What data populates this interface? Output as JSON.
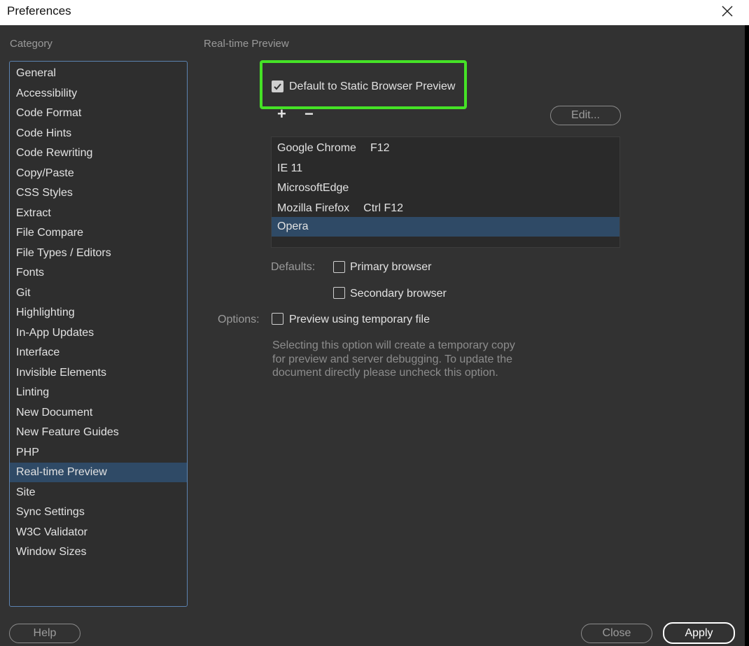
{
  "window": {
    "title": "Preferences",
    "close_icon": "close-icon"
  },
  "sidebar": {
    "heading": "Category",
    "items": [
      {
        "label": "General"
      },
      {
        "label": "Accessibility"
      },
      {
        "label": "Code Format"
      },
      {
        "label": "Code Hints"
      },
      {
        "label": "Code Rewriting"
      },
      {
        "label": "Copy/Paste"
      },
      {
        "label": "CSS Styles"
      },
      {
        "label": "Extract"
      },
      {
        "label": "File Compare"
      },
      {
        "label": "File Types / Editors"
      },
      {
        "label": "Fonts"
      },
      {
        "label": "Git"
      },
      {
        "label": "Highlighting"
      },
      {
        "label": "In-App Updates"
      },
      {
        "label": "Interface"
      },
      {
        "label": "Invisible Elements"
      },
      {
        "label": "Linting"
      },
      {
        "label": "New Document"
      },
      {
        "label": "New Feature Guides"
      },
      {
        "label": "PHP"
      },
      {
        "label": "Real-time Preview"
      },
      {
        "label": "Site"
      },
      {
        "label": "Sync Settings"
      },
      {
        "label": "W3C Validator"
      },
      {
        "label": "Window Sizes"
      }
    ],
    "selected": "Real-time Preview"
  },
  "main": {
    "section_title": "Real-time Preview",
    "static_preview": {
      "label": "Default to Static Browser Preview",
      "checked": true
    },
    "add_symbol": "+",
    "remove_symbol": "−",
    "edit_button": "Edit...",
    "browsers": [
      {
        "name": "Google Chrome",
        "shortcut": "F12"
      },
      {
        "name": "IE 11",
        "shortcut": ""
      },
      {
        "name": "MicrosoftEdge",
        "shortcut": ""
      },
      {
        "name": "Mozilla Firefox",
        "shortcut": "Ctrl F12"
      },
      {
        "name": "Opera",
        "shortcut": ""
      }
    ],
    "selected_browser": "Opera",
    "defaults_label": "Defaults:",
    "primary_browser": {
      "label": "Primary browser",
      "checked": false
    },
    "secondary_browser": {
      "label": "Secondary browser",
      "checked": false
    },
    "options_label": "Options:",
    "temp_file": {
      "label": "Preview using temporary file",
      "checked": false
    },
    "help_lines": [
      "Selecting this option will create a temporary copy",
      "for preview and server debugging. To update the",
      "document directly please uncheck this option."
    ]
  },
  "footer": {
    "help_button": "Help",
    "close_button": "Close",
    "apply_button": "Apply"
  },
  "colors": {
    "highlight": "#45e226",
    "selection": "#2f4a66",
    "list_border": "#5b82b0"
  }
}
